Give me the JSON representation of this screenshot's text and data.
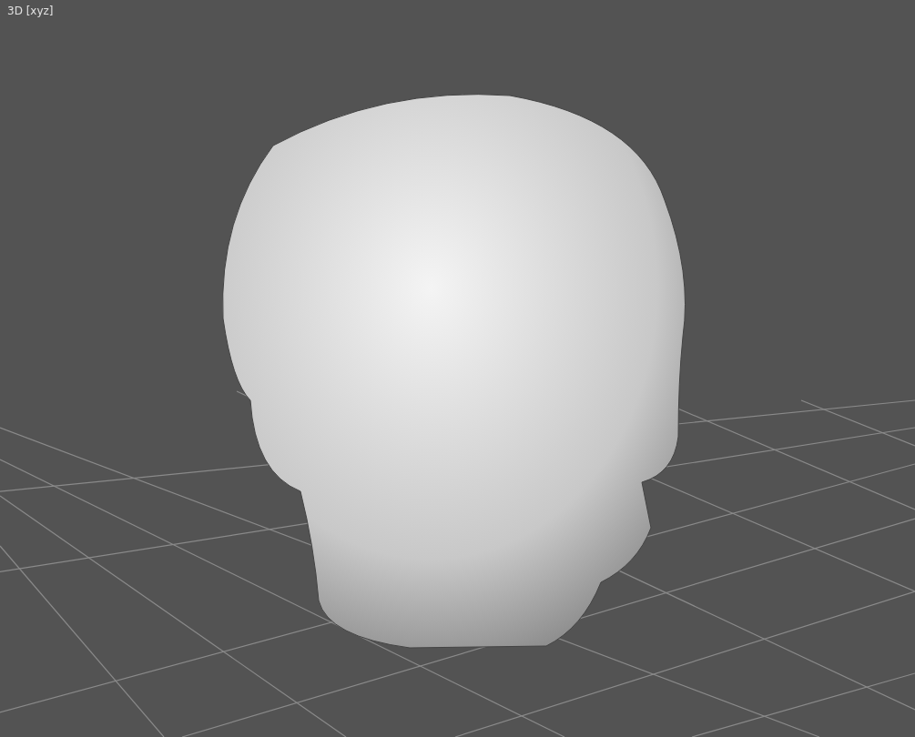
{
  "viewport": {
    "label": "3D [xyz]"
  }
}
